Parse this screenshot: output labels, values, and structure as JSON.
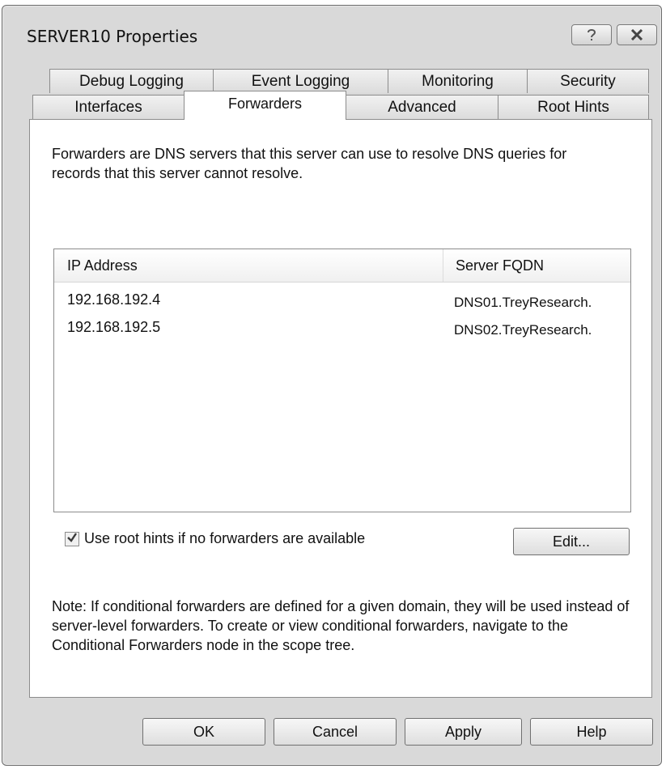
{
  "window": {
    "title": "SERVER10 Properties"
  },
  "tabs_row1": [
    "Debug Logging",
    "Event Logging",
    "Monitoring",
    "Security"
  ],
  "tabs_row2": [
    "Interfaces",
    "Forwarders",
    "Advanced",
    "Root Hints"
  ],
  "active_tab": "Forwarders",
  "forwarders": {
    "description": "Forwarders are DNS servers that this server can use to resolve DNS queries for records that this server cannot resolve.",
    "list": {
      "columns": [
        "IP Address",
        "Server FQDN"
      ],
      "rows": [
        {
          "ip": "192.168.192.4",
          "fqdn": "DNS01.TreyResearch."
        },
        {
          "ip": "192.168.192.5",
          "fqdn": "DNS02.TreyResearch."
        }
      ]
    },
    "use_root_hints": {
      "label": "Use root hints if no forwarders are available",
      "checked": true
    },
    "edit_label": "Edit...",
    "note": "Note: If conditional forwarders are defined for a given domain, they will be used instead of server-level forwarders.  To create or view conditional forwarders, navigate to the Conditional Forwarders node in the scope tree."
  },
  "buttons": {
    "ok": "OK",
    "cancel": "Cancel",
    "apply": "Apply",
    "help": "Help"
  },
  "icons": {
    "help": "help-icon",
    "close": "close-icon",
    "check": "checkmark-icon"
  }
}
